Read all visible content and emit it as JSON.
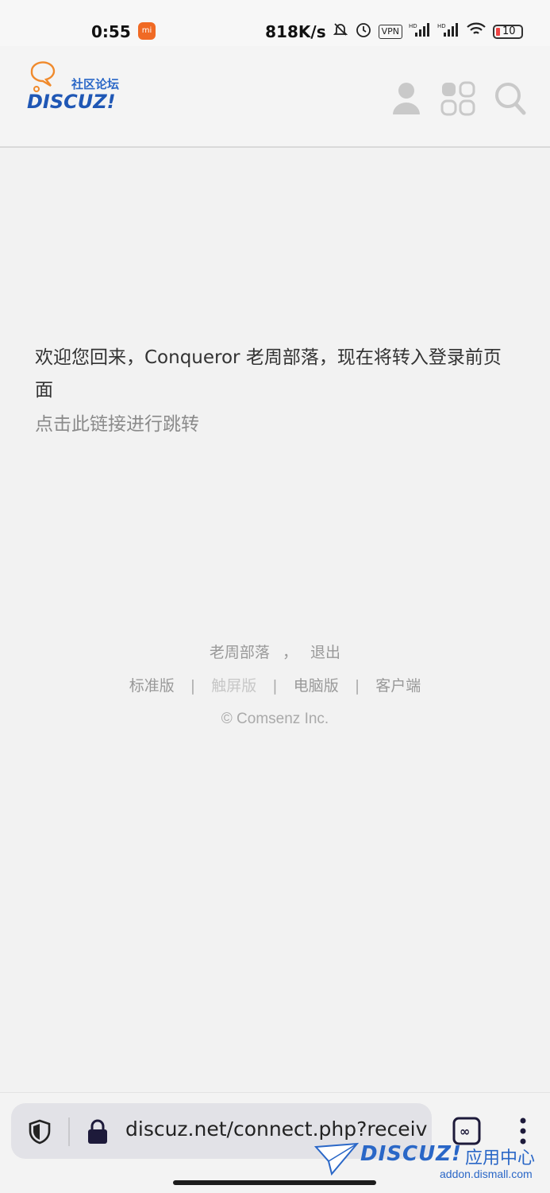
{
  "status_bar": {
    "time": "0:55",
    "mi_badge": "mi",
    "net_speed": "818K/s",
    "vpn": "VPN",
    "battery": "10"
  },
  "header": {
    "logo_cn": "社区论坛",
    "logo_en": "DISCUZ!"
  },
  "message": {
    "welcome": "欢迎您回来，Conqueror 老周部落，现在将转入登录前页面",
    "link": "点击此链接进行跳转"
  },
  "footer": {
    "user": "老周部落",
    "comma": "，",
    "logout": "退出",
    "standard": "标准版",
    "touch": "触屏版",
    "desktop": "电脑版",
    "client": "客户端",
    "sep": "|",
    "copyright": "© Comsenz Inc."
  },
  "browser": {
    "url": "discuz.net/connect.php?receiv"
  },
  "watermark": {
    "brand": "DISCUZ!",
    "cn": "应用中心",
    "site": "addon.dismall.com"
  },
  "colors": {
    "accent": "#2a67c7",
    "logo_orange": "#f08a2c"
  }
}
